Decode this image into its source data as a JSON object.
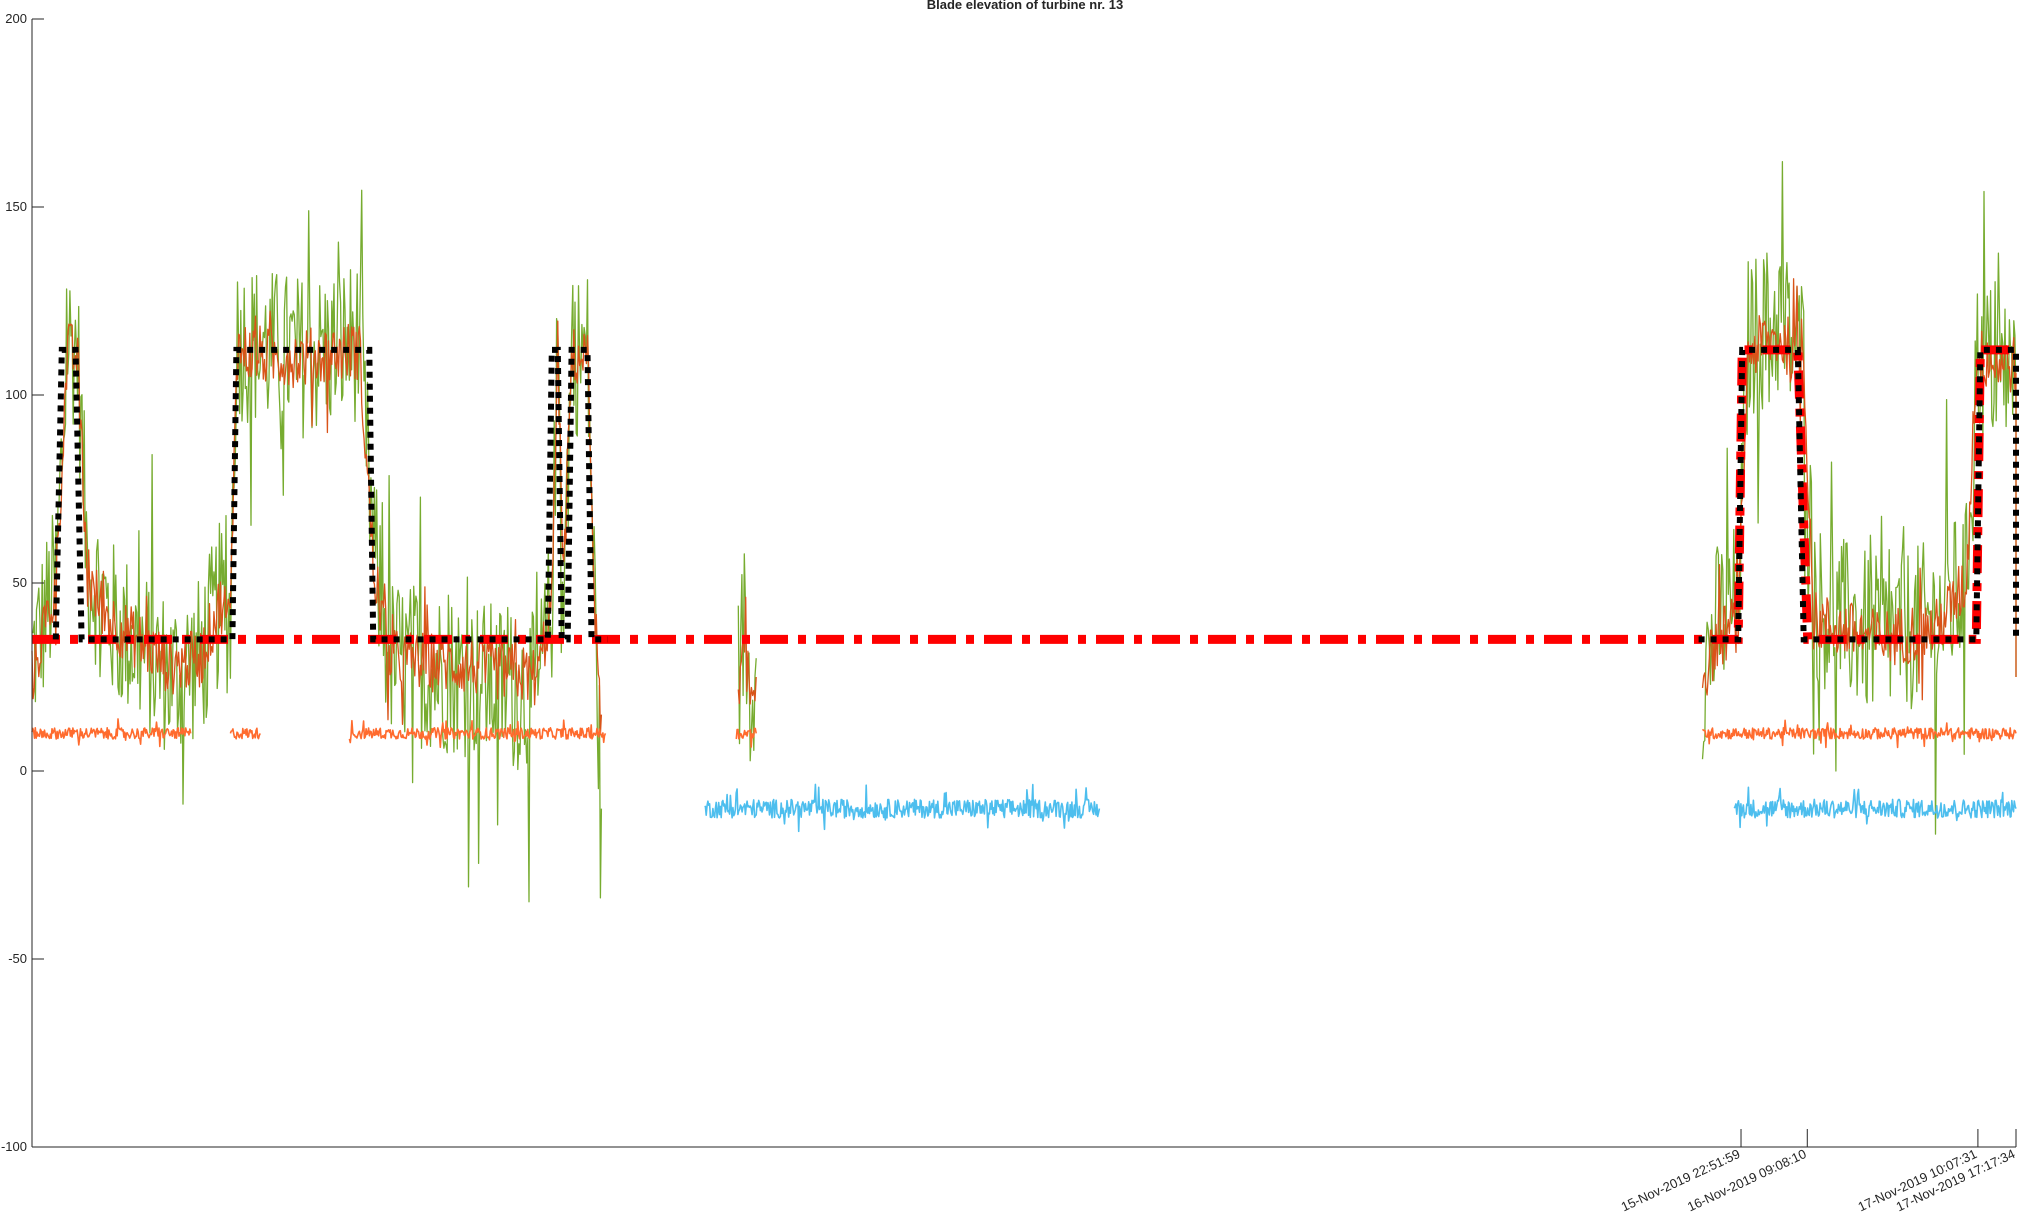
{
  "chart_data": {
    "type": "line",
    "title": "Blade elevation of turbine nr. 13",
    "xlabel": "",
    "ylabel": "",
    "ylim": [
      -100,
      200
    ],
    "yticks": [
      -100,
      -50,
      0,
      50,
      100,
      150,
      200
    ],
    "x_is_fraction_of_time_range": true,
    "x_range": [
      0,
      1
    ],
    "xticks": [
      {
        "x": 0.8614,
        "label": "15-Nov-2019 22:51:59"
      },
      {
        "x": 0.8948,
        "label": "16-Nov-2019 09:08:10"
      },
      {
        "x": 0.9808,
        "label": "17-Nov-2019 10:07:31"
      },
      {
        "x": 1.0,
        "label": "17-Nov-2019 17:17:34"
      }
    ],
    "grid": false,
    "series": [
      {
        "style": "noisy",
        "color": "#77ac30",
        "noise": 22,
        "segments": [
          [
            [
              0.0,
              30
            ],
            [
              0.012,
              50
            ],
            [
              0.018,
              115
            ],
            [
              0.023,
              112
            ],
            [
              0.028,
              55
            ],
            [
              0.04,
              40
            ],
            [
              0.07,
              25
            ],
            [
              0.085,
              30
            ],
            [
              0.095,
              45
            ],
            [
              0.1,
              40
            ],
            [
              0.103,
              115
            ],
            [
              0.12,
              112
            ],
            [
              0.14,
              110
            ],
            [
              0.165,
              115
            ],
            [
              0.172,
              60
            ],
            [
              0.18,
              30
            ],
            [
              0.22,
              25
            ],
            [
              0.255,
              20
            ],
            [
              0.262,
              45
            ],
            [
              0.265,
              115
            ],
            [
              0.268,
              50
            ],
            [
              0.272,
              110
            ],
            [
              0.28,
              112
            ],
            [
              0.285,
              20
            ],
            [
              0.287,
              -10
            ]
          ],
          [
            [
              0.356,
              25
            ],
            [
              0.359,
              40
            ],
            [
              0.362,
              20
            ],
            [
              0.365,
              30
            ]
          ],
          [
            [
              0.842,
              25
            ],
            [
              0.85,
              40
            ],
            [
              0.86,
              45
            ],
            [
              0.865,
              115
            ],
            [
              0.88,
              120
            ],
            [
              0.893,
              110
            ],
            [
              0.898,
              45
            ],
            [
              0.93,
              35
            ],
            [
              0.96,
              40
            ],
            [
              0.975,
              50
            ],
            [
              0.98,
              110
            ],
            [
              1.0,
              105
            ],
            [
              1.0,
              25
            ]
          ]
        ]
      },
      {
        "style": "noisy",
        "color": "#d95319",
        "noise": 8,
        "segments": [
          [
            [
              0.0,
              25
            ],
            [
              0.012,
              50
            ],
            [
              0.018,
              112
            ],
            [
              0.023,
              110
            ],
            [
              0.028,
              50
            ],
            [
              0.04,
              40
            ],
            [
              0.07,
              28
            ],
            [
              0.085,
              30
            ],
            [
              0.095,
              45
            ],
            [
              0.1,
              40
            ],
            [
              0.103,
              112
            ],
            [
              0.12,
              110
            ],
            [
              0.14,
              110
            ],
            [
              0.165,
              112
            ],
            [
              0.172,
              55
            ],
            [
              0.18,
              30
            ],
            [
              0.22,
              28
            ],
            [
              0.255,
              25
            ],
            [
              0.262,
              45
            ],
            [
              0.265,
              112
            ],
            [
              0.268,
              50
            ],
            [
              0.272,
              110
            ],
            [
              0.28,
              110
            ],
            [
              0.285,
              25
            ],
            [
              0.287,
              15
            ]
          ],
          [
            [
              0.356,
              15
            ],
            [
              0.358,
              30
            ],
            [
              0.362,
              20
            ],
            [
              0.365,
              25
            ]
          ],
          [
            [
              0.842,
              25
            ],
            [
              0.85,
              35
            ],
            [
              0.86,
              40
            ],
            [
              0.865,
              112
            ],
            [
              0.88,
              115
            ],
            [
              0.893,
              110
            ],
            [
              0.898,
              40
            ],
            [
              0.93,
              35
            ],
            [
              0.96,
              38
            ],
            [
              0.975,
              50
            ],
            [
              0.98,
              110
            ],
            [
              1.0,
              108
            ],
            [
              1.0,
              25
            ]
          ]
        ]
      },
      {
        "style": "band",
        "color": "#ff6b2e",
        "noise": 1.5,
        "segments": [
          [
            [
              0.0,
              10
            ],
            [
              0.08,
              10
            ]
          ],
          [
            [
              0.1,
              10
            ],
            [
              0.115,
              10
            ]
          ],
          [
            [
              0.16,
              10
            ],
            [
              0.289,
              10
            ]
          ],
          [
            [
              0.355,
              10
            ],
            [
              0.365,
              10
            ]
          ],
          [
            [
              0.842,
              10
            ],
            [
              1.0,
              10
            ]
          ]
        ]
      },
      {
        "style": "band",
        "color": "#4dbeee",
        "noise": 2.5,
        "segments": [
          [
            [
              0.339,
              -10
            ],
            [
              0.538,
              -10
            ]
          ],
          [
            [
              0.858,
              -10
            ],
            [
              1.0,
              -10
            ]
          ]
        ]
      },
      {
        "style": "dashed-dot",
        "color": "#ff0000",
        "width": 9,
        "segments": [
          [
            [
              0.0,
              35
            ],
            [
              0.86,
              35
            ],
            [
              0.862,
              112
            ],
            [
              0.89,
              112
            ],
            [
              0.895,
              35
            ],
            [
              0.98,
              35
            ],
            [
              0.982,
              112
            ],
            [
              1.0,
              112
            ]
          ]
        ]
      },
      {
        "style": "dotted",
        "color": "#000000",
        "width": 6,
        "segments": [
          [
            [
              0.012,
              35
            ],
            [
              0.015,
              112
            ],
            [
              0.022,
              112
            ],
            [
              0.025,
              35
            ],
            [
              0.101,
              35
            ],
            [
              0.103,
              112
            ],
            [
              0.17,
              112
            ],
            [
              0.172,
              35
            ],
            [
              0.26,
              35
            ],
            [
              0.262,
              112
            ],
            [
              0.265,
              112
            ],
            [
              0.267,
              35
            ],
            [
              0.27,
              35
            ],
            [
              0.272,
              112
            ],
            [
              0.28,
              112
            ],
            [
              0.282,
              35
            ],
            [
              0.29,
              35
            ]
          ],
          [
            [
              0.84,
              35
            ],
            [
              0.86,
              35
            ],
            [
              0.862,
              112
            ],
            [
              0.89,
              112
            ],
            [
              0.893,
              35
            ],
            [
              0.98,
              35
            ],
            [
              0.982,
              112
            ],
            [
              1.0,
              112
            ],
            [
              1.0,
              35
            ]
          ]
        ]
      }
    ]
  }
}
